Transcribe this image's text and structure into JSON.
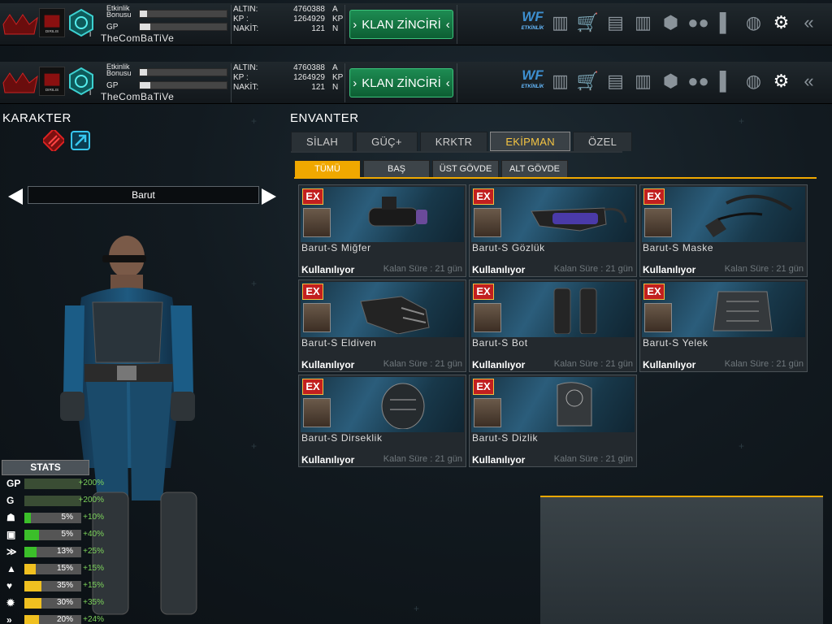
{
  "topbar": {
    "bonus_label": "Etkinlik\nBonusu",
    "gp_label": "GP",
    "bonus_bar_fraction": 0.08,
    "gp_bar_fraction": 0.12,
    "username": "TheComBaTiVe",
    "rank_suffix": "I",
    "clan_label": "DIRILIS",
    "currencies": [
      {
        "label": "ALTIN:",
        "value": "4760388",
        "unit": "A"
      },
      {
        "label": "KP :",
        "value": "1264929",
        "unit": "KP"
      },
      {
        "label": "NAKİT:",
        "value": "121",
        "unit": "N"
      }
    ],
    "klan_button": "KLAN ZİNCİRİ",
    "icons": [
      "etkinlik-icon",
      "ranking-icon",
      "cart-icon",
      "chest-icon",
      "barracks-icon",
      "box-icon",
      "friends-icon",
      "stats-icon",
      "globe-icon",
      "gear-icon",
      "back-icon"
    ],
    "etkinlik_label": "ETKİNLİK"
  },
  "karakter": {
    "title": "KARAKTER",
    "selected_set": "Barut"
  },
  "stats": {
    "title": "STATS",
    "rows": [
      {
        "icon": "GP",
        "pct": "",
        "bonus": "+200%",
        "fill": 1.0,
        "color": "#7dd35b"
      },
      {
        "icon": "G",
        "pct": "",
        "bonus": "+200%",
        "fill": 1.0,
        "color": "#7dd35b"
      },
      {
        "icon": "head-icon",
        "pct": "5%",
        "bonus": "+10%",
        "fill": 0.12,
        "color": "#3bbf2a"
      },
      {
        "icon": "chest-armor-icon",
        "pct": "5%",
        "bonus": "+40%",
        "fill": 0.25,
        "color": "#3bbf2a"
      },
      {
        "icon": "speed-icon",
        "pct": "13%",
        "bonus": "+25%",
        "fill": 0.22,
        "color": "#3bbf2a"
      },
      {
        "icon": "jump-icon",
        "pct": "15%",
        "bonus": "+15%",
        "fill": 0.2,
        "color": "#f0c020"
      },
      {
        "icon": "heart-icon",
        "pct": "35%",
        "bonus": "+15%",
        "fill": 0.3,
        "color": "#f0c020"
      },
      {
        "icon": "burst-icon",
        "pct": "30%",
        "bonus": "+35%",
        "fill": 0.3,
        "color": "#f0c020"
      },
      {
        "icon": "dash-icon",
        "pct": "20%",
        "bonus": "+24%",
        "fill": 0.25,
        "color": "#f0c020"
      }
    ]
  },
  "envanter": {
    "title": "ENVANTER",
    "tabs": [
      "SİLAH",
      "GÜÇ+",
      "KRKTR",
      "EKİPMAN",
      "ÖZEL"
    ],
    "active_tab": 3,
    "subtabs": [
      "TÜMÜ",
      "BAŞ",
      "ÜST GÖVDE",
      "ALT GÖVDE"
    ],
    "active_subtab": 0,
    "items": [
      {
        "name": "Barut-S Miğfer",
        "status": "Kullanılıyor",
        "time": "Kalan Süre : 21 gün",
        "badge": "EX",
        "thumb": "helmet"
      },
      {
        "name": "Barut-S Gözlük",
        "status": "Kullanılıyor",
        "time": "Kalan Süre : 21 gün",
        "badge": "EX",
        "thumb": "goggles"
      },
      {
        "name": "Barut-S Maske",
        "status": "Kullanılıyor",
        "time": "Kalan Süre : 21 gün",
        "badge": "EX",
        "thumb": "mask"
      },
      {
        "name": "Barut-S Eldiven",
        "status": "Kullanılıyor",
        "time": "Kalan Süre : 21 gün",
        "badge": "EX",
        "thumb": "glove"
      },
      {
        "name": "Barut-S Bot",
        "status": "Kullanılıyor",
        "time": "Kalan Süre : 21 gün",
        "badge": "EX",
        "thumb": "boots"
      },
      {
        "name": "Barut-S Yelek",
        "status": "Kullanılıyor",
        "time": "Kalan Süre : 21 gün",
        "badge": "EX",
        "thumb": "vest"
      },
      {
        "name": "Barut-S Dirseklik",
        "status": "Kullanılıyor",
        "time": "Kalan Süre : 21 gün",
        "badge": "EX",
        "thumb": "elbow"
      },
      {
        "name": "Barut-S Dizlik",
        "status": "Kullanılıyor",
        "time": "Kalan Süre : 21 gün",
        "badge": "EX",
        "thumb": "knee"
      }
    ]
  }
}
